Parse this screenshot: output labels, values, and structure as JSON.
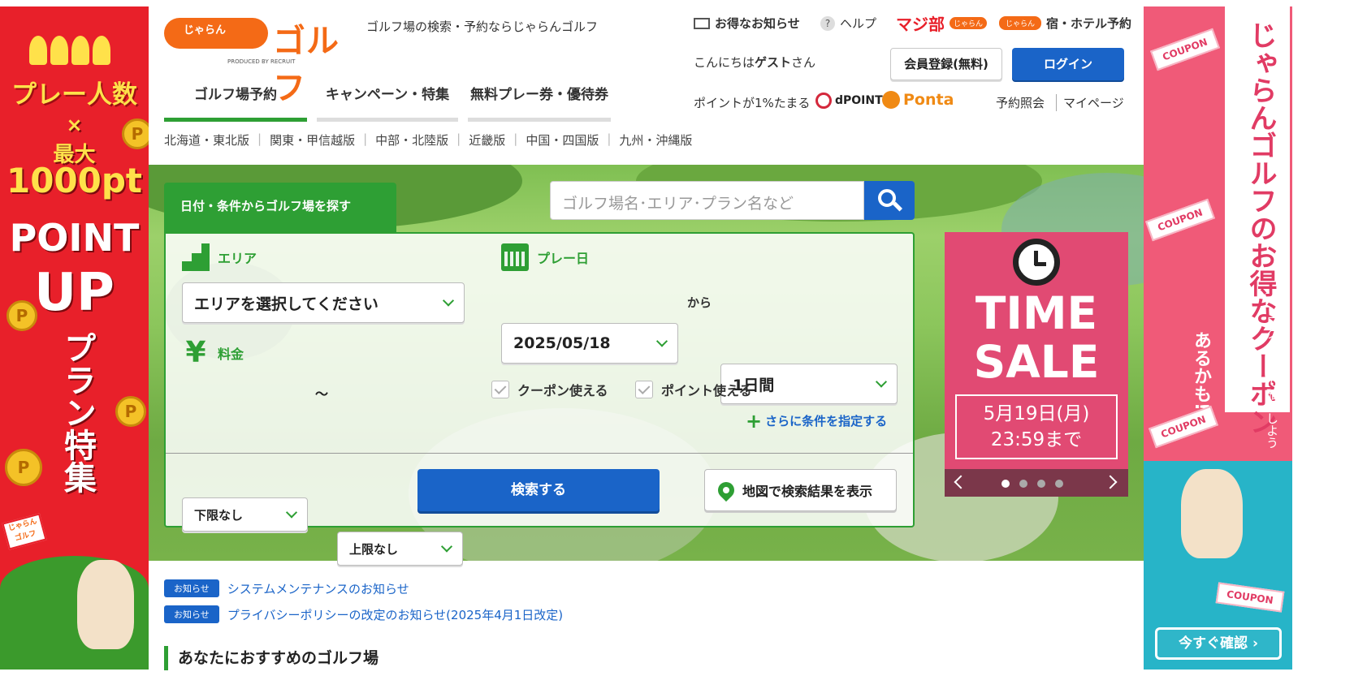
{
  "left_ad": {
    "headline": "プレー人数",
    "times": "×",
    "max": "最大",
    "points": "1000pt",
    "point_word": "POINT",
    "up_word": "UP",
    "feature": "プラン特集",
    "coin": "P",
    "flag": "じゃらん ゴルフ"
  },
  "right_ad": {
    "main_text": "じゃらんゴルフのお得なクーポン",
    "sub_text": "あるかも!?",
    "login_hint": "ログインして確認しよう",
    "coupon_label": "COUPON",
    "cta": "今すぐ確認 ›"
  },
  "header": {
    "logo_script": "じゃらん",
    "logo_text": "ゴルフ",
    "logo_produced": "PRODUCED BY RECRUIT",
    "tagline": "ゴルフ場の検索・予約ならじゃらんゴルフ",
    "news_link": "お得なお知らせ",
    "help_link": "ヘルプ",
    "majibu_link": "マジ部",
    "majibu_sub": "じゃらん",
    "hotel_link": "宿・ホテル予約",
    "hotel_logo": "じゃらん",
    "greeting_pre": "こんにちは",
    "greeting_name": "ゲスト",
    "greeting_post": "さん",
    "register_button": "会員登録(無料)",
    "login_button": "ログイン",
    "points_text": "ポイントが1%たまる",
    "dpoint": "dPOINT",
    "ponta": "Ponta",
    "reservation_link": "予約照会",
    "mypage_link": "マイページ",
    "help_icon": "?"
  },
  "nav": {
    "tabs": [
      "ゴルフ場予約",
      "キャンペーン・特集",
      "無料プレー券・優待券"
    ],
    "regions": [
      "北海道・東北版",
      "関東・甲信越版",
      "中部・北陸版",
      "近畿版",
      "中国・四国版",
      "九州・沖縄版"
    ]
  },
  "search": {
    "tab_label": "日付・条件からゴルフ場を探す",
    "keyword_placeholder": "ゴルフ場名･エリア･プラン名など",
    "area_label": "エリア",
    "area_value": "エリアを選択してください",
    "date_label": "プレー日",
    "date_value": "2025/05/18",
    "kara": "から",
    "days_value": "1日間",
    "price_label": "料金",
    "yen": "¥",
    "price_min": "下限なし",
    "tilde": "〜",
    "price_max": "上限なし",
    "coupon_check": "クーポン使える",
    "point_check": "ポイント使える",
    "more_conditions": "さらに条件を指定する",
    "plus": "+",
    "search_button": "検索する",
    "map_button": "地図で検索結果を表示"
  },
  "sale": {
    "title_line1": "TIME",
    "title_line2": "SALE",
    "date_line1": "5月19日(月)",
    "date_line2": "23:59まで",
    "active_slide": 1,
    "slide_count": 4
  },
  "notices": [
    {
      "badge": "お知らせ",
      "text": "システムメンテナンスのお知らせ"
    },
    {
      "badge": "お知らせ",
      "text": "プライバシーポリシーの改定のお知らせ(2025年4月1日改定)"
    }
  ],
  "recommend_title": "あなたにおすすめのゴルフ場",
  "colors": {
    "brand_orange": "#f46a16",
    "green": "#2e9f34",
    "blue": "#1a64c8",
    "sale_pink": "#e14a73"
  }
}
